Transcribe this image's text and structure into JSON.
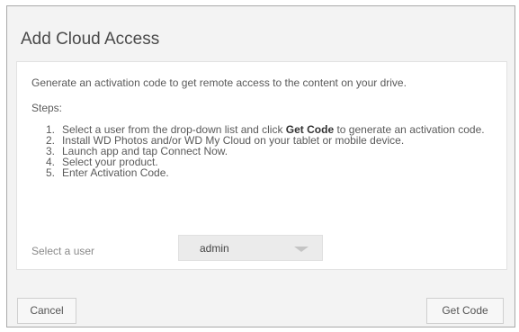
{
  "dialog": {
    "title": "Add Cloud Access",
    "intro": "Generate an activation code to get remote access to the content on your drive.",
    "steps_label": "Steps:",
    "steps": [
      {
        "num": "1.",
        "pre": "Select a user from the drop-down list and click ",
        "bold": "Get Code",
        "post": " to generate an activation code."
      },
      {
        "num": "2.",
        "pre": "Install WD Photos and/or WD My Cloud on your tablet or mobile device.",
        "bold": "",
        "post": ""
      },
      {
        "num": "3.",
        "pre": "Launch app and tap Connect Now.",
        "bold": "",
        "post": ""
      },
      {
        "num": "4.",
        "pre": "Select your product.",
        "bold": "",
        "post": ""
      },
      {
        "num": "5.",
        "pre": "Enter Activation Code.",
        "bold": "",
        "post": ""
      }
    ],
    "user_select": {
      "label": "Select a user",
      "value": "admin"
    },
    "buttons": {
      "cancel": "Cancel",
      "get_code": "Get Code"
    }
  }
}
